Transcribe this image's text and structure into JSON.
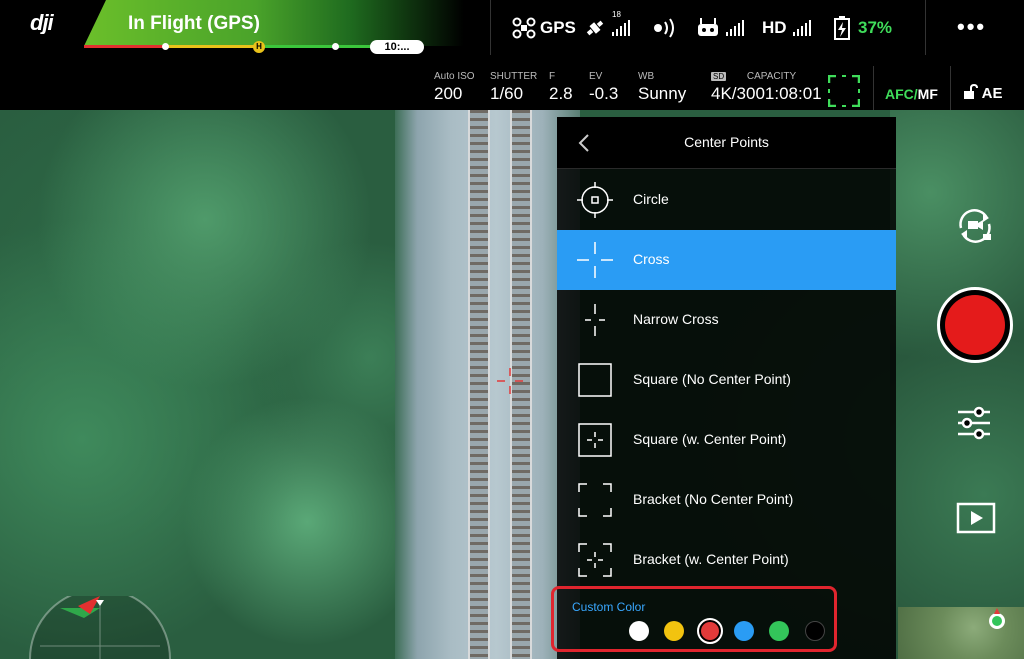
{
  "topbar": {
    "status": "In Flight (GPS)",
    "flight_time": "10:...",
    "gps_label": "GPS",
    "satellites": "18",
    "hd_label": "HD",
    "battery_pct": "37%",
    "more_label": "•••"
  },
  "params": {
    "iso_label": "Auto ISO",
    "iso_value": "200",
    "shutter_label": "SHUTTER",
    "shutter_value": "1/60",
    "f_label": "F",
    "f_value": "2.8",
    "ev_label": "EV",
    "ev_value": "-0.3",
    "wb_label": "WB",
    "wb_value": "Sunny",
    "sd_label": "SD",
    "capacity_label": "CAPACITY",
    "resolution_value": "4K/30",
    "capacity_value": "01:08:01",
    "afc_label": "AFC/",
    "mf_label": "MF",
    "ae_label": "AE"
  },
  "panel": {
    "title": "Center Points",
    "options": [
      {
        "label": "Circle",
        "selected": false
      },
      {
        "label": "Cross",
        "selected": true
      },
      {
        "label": "Narrow Cross",
        "selected": false
      },
      {
        "label": "Square (No Center Point)",
        "selected": false
      },
      {
        "label": "Square (w. Center Point)",
        "selected": false
      },
      {
        "label": "Bracket (No Center Point)",
        "selected": false
      },
      {
        "label": "Bracket (w. Center Point)",
        "selected": false
      }
    ],
    "custom_color_label": "Custom Color",
    "colors": [
      "#ffffff",
      "#f2c30f",
      "#e23a3a",
      "#2a9cf4",
      "#33c55a",
      "#000000"
    ],
    "selected_color": "#e23a3a"
  },
  "colors": {
    "accent_blue": "#2a9cf4",
    "record_red": "#e41b1b",
    "status_green": "#3fdc5a",
    "highlight_box": "#e0252e"
  }
}
